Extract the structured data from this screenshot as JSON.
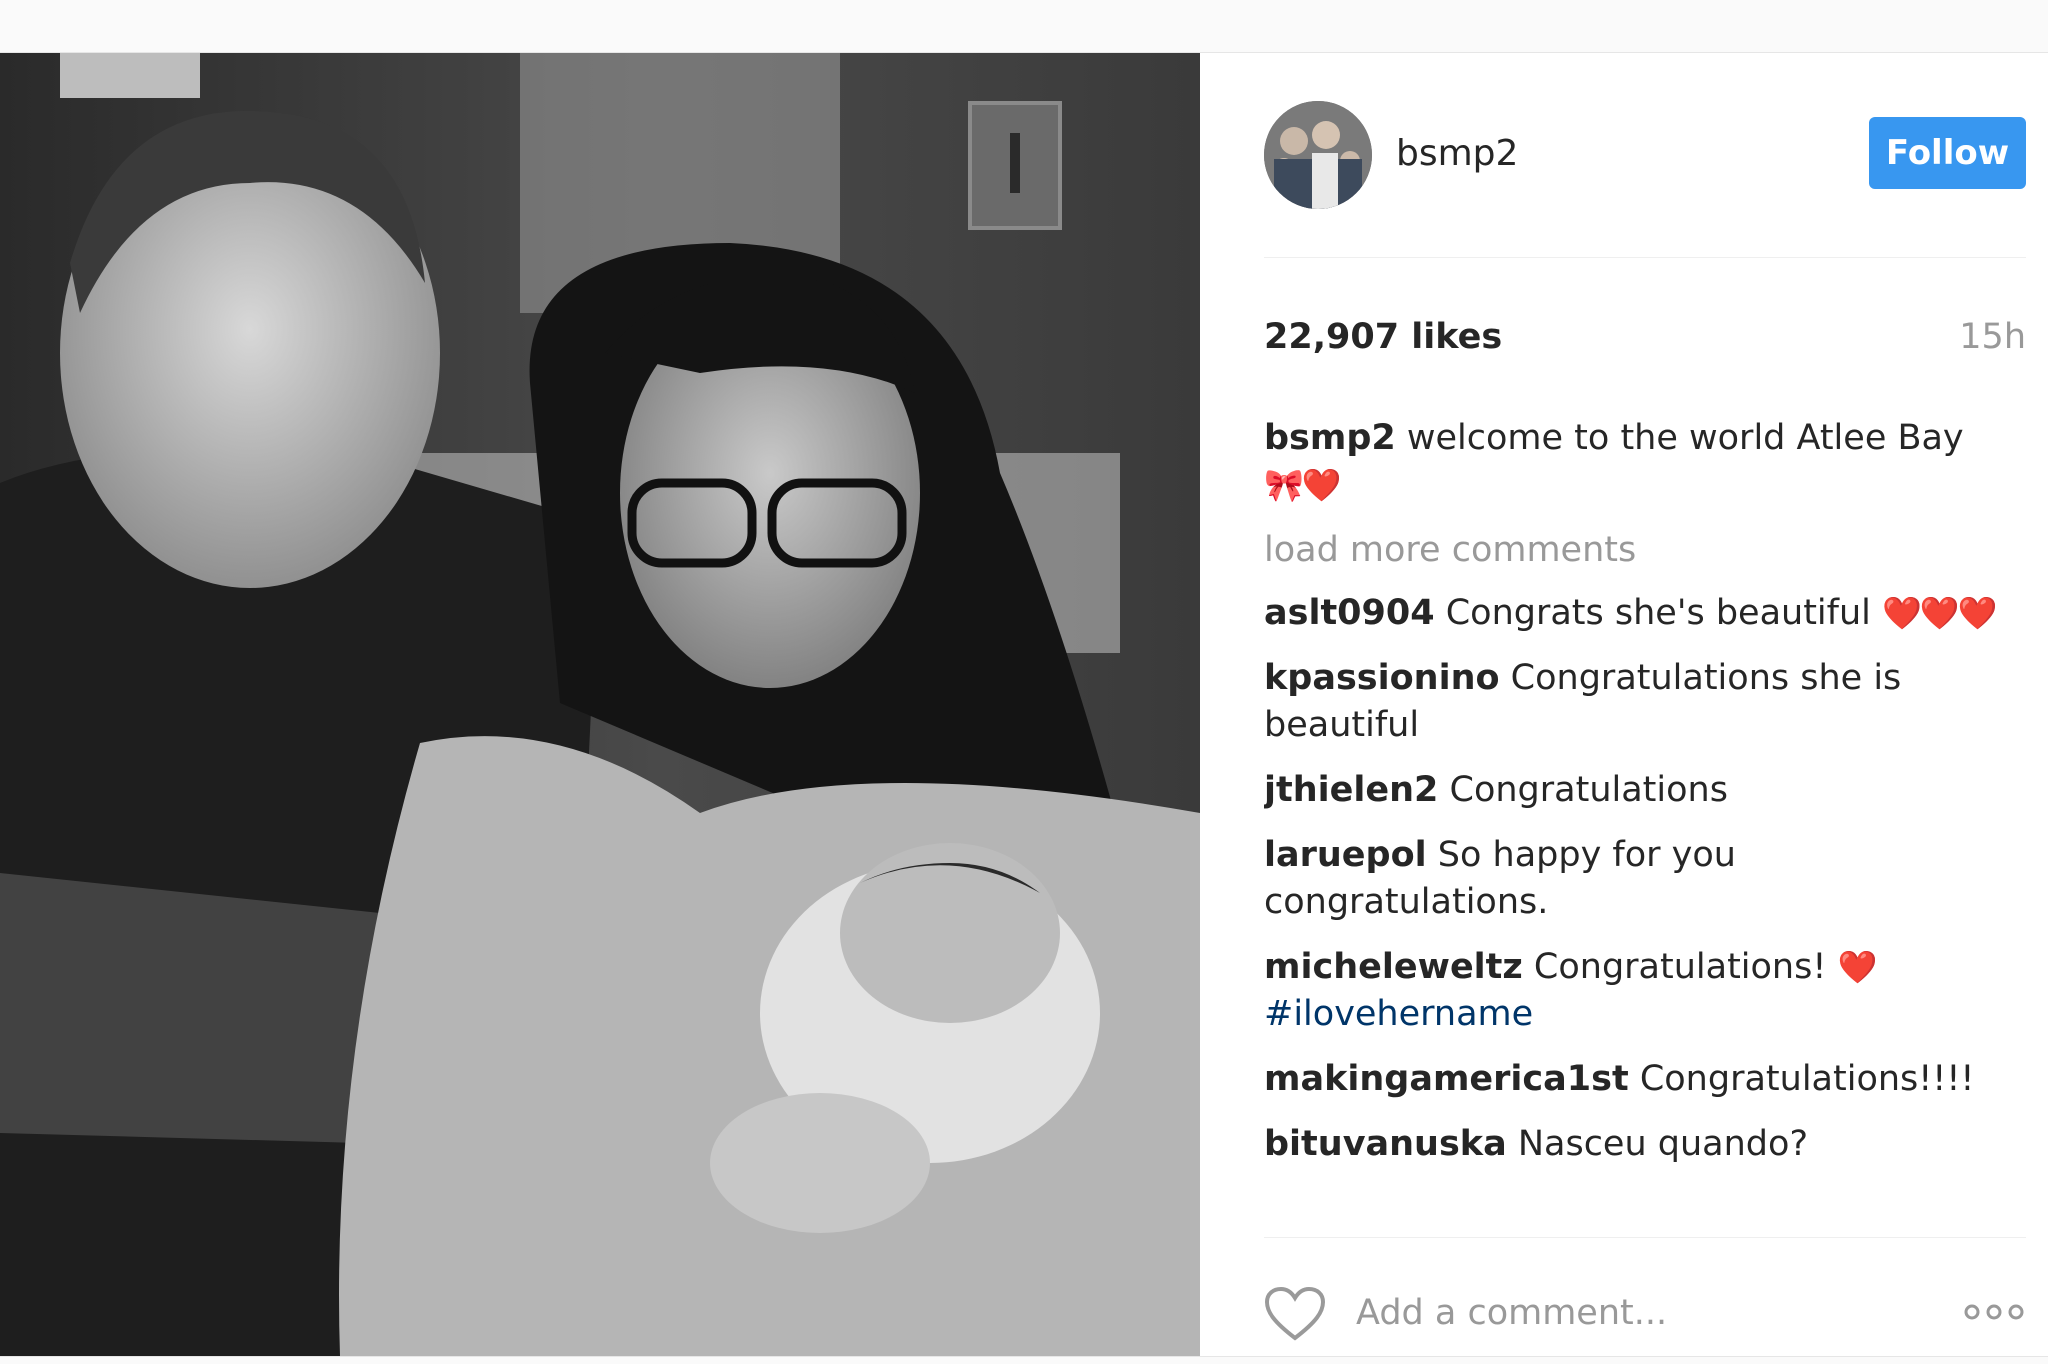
{
  "post": {
    "username": "bsmp2",
    "follow_label": "Follow",
    "likes": "22,907 likes",
    "time": "15h",
    "caption": {
      "user": "bsmp2",
      "text": " welcome to the world Atlee Bay",
      "emoji": "🎀❤️"
    },
    "load_more": "load more comments",
    "comments": [
      {
        "user": "aslt0904",
        "text": " Congrats she's beautiful ",
        "emoji": "❤️❤️❤️"
      },
      {
        "user": "kpassionino",
        "text": " Congratulations she is beautiful",
        "emoji": ""
      },
      {
        "user": "jthielen2",
        "text": " Congratulations",
        "emoji": ""
      },
      {
        "user": "laruepol",
        "text": " So happy for you congratulations.",
        "emoji": ""
      },
      {
        "user": "micheleweltz",
        "text": " Congratulations! ",
        "emoji": "❤️",
        "hashtag": "#ilovehername"
      },
      {
        "user": "makingamerica1st",
        "text": " Congratulations!!!!",
        "emoji": ""
      },
      {
        "user": "bituvanuska",
        "text": " Nasceu quando?",
        "emoji": ""
      }
    ],
    "comment_placeholder": "Add a comment...",
    "icons": {
      "like": "heart-outline-icon",
      "more": "more-options-icon"
    },
    "colors": {
      "follow_bg": "#3897f0",
      "hashtag": "#003569",
      "muted": "#999999"
    }
  }
}
